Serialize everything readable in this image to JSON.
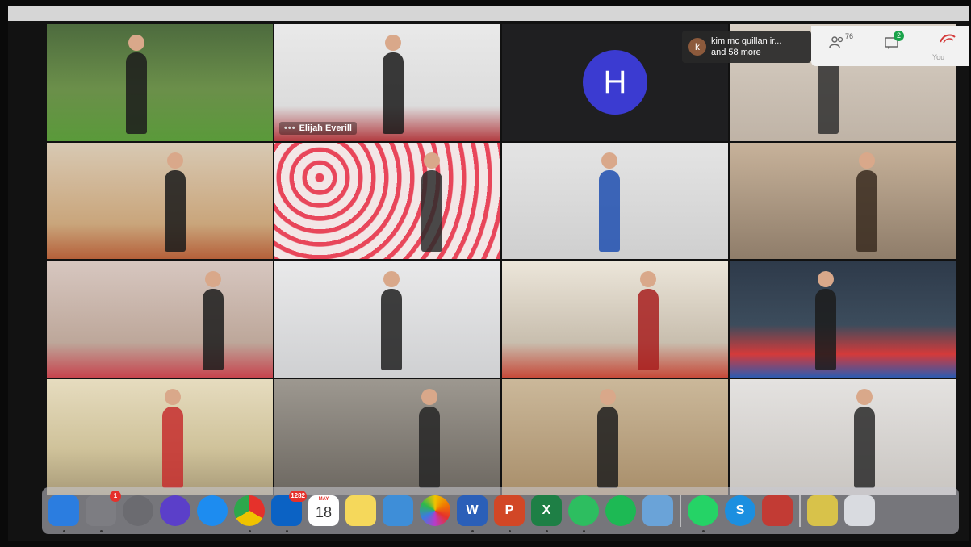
{
  "meeting": {
    "tiles": [
      {
        "scene": "garden-selfie"
      },
      {
        "scene": "speaker",
        "name": "Elijah Everill"
      },
      {
        "scene": "avatar",
        "initial": "H"
      },
      {
        "scene": "room"
      },
      {
        "scene": "hallway"
      },
      {
        "scene": "floral-wall"
      },
      {
        "scene": "blue-shirt"
      },
      {
        "scene": "kitchen"
      },
      {
        "scene": "living-room"
      },
      {
        "scene": "white-room"
      },
      {
        "scene": "dojo-bags"
      },
      {
        "scene": "gym-mats"
      },
      {
        "scene": "backyard"
      },
      {
        "scene": "lounge-closeup"
      },
      {
        "scene": "lounge"
      },
      {
        "scene": "home-gym"
      }
    ],
    "notification": {
      "avatar_letter": "k",
      "line1": "kim mc quillan ir...",
      "line2": "and 58 more"
    },
    "panel": {
      "people_count": "76",
      "chat_badge": "2",
      "you_label": "You"
    }
  },
  "dock": {
    "items": [
      {
        "name": "finder",
        "color": "#2b7de0"
      },
      {
        "name": "system-preferences",
        "color": "#7d7d82",
        "badge": "1"
      },
      {
        "name": "launchpad",
        "color": "#6b6b70"
      },
      {
        "name": "siri",
        "color": "#5b3fc9"
      },
      {
        "name": "app-store",
        "color": "#1d8cf0"
      },
      {
        "name": "chrome",
        "color": "#e0a22b"
      },
      {
        "name": "outlook",
        "color": "#0b62c4",
        "badge": "1282"
      },
      {
        "name": "calendar",
        "color": "#ffffff",
        "month": "MAY",
        "day": "18"
      },
      {
        "name": "notes",
        "color": "#f5d85b"
      },
      {
        "name": "preview",
        "color": "#3e8ed8"
      },
      {
        "name": "photos",
        "color": "#ffffff"
      },
      {
        "name": "word",
        "color": "#2b5fb8",
        "letter": "W"
      },
      {
        "name": "powerpoint",
        "color": "#d24726",
        "letter": "P"
      },
      {
        "name": "excel",
        "color": "#1e7f45",
        "letter": "X"
      },
      {
        "name": "evernote",
        "color": "#2dbe60"
      },
      {
        "name": "spotify",
        "color": "#1db954"
      },
      {
        "name": "image-capture",
        "color": "#6aa3d8"
      },
      {
        "name": "whatsapp",
        "color": "#25d366"
      },
      {
        "name": "skype",
        "color": "#1b8fe0",
        "letter": "S"
      },
      {
        "name": "photo-booth",
        "color": "#c23b34"
      },
      {
        "name": "downloads",
        "color": "#d8c24a"
      },
      {
        "name": "trash",
        "color": "#d9dbe0"
      }
    ]
  }
}
